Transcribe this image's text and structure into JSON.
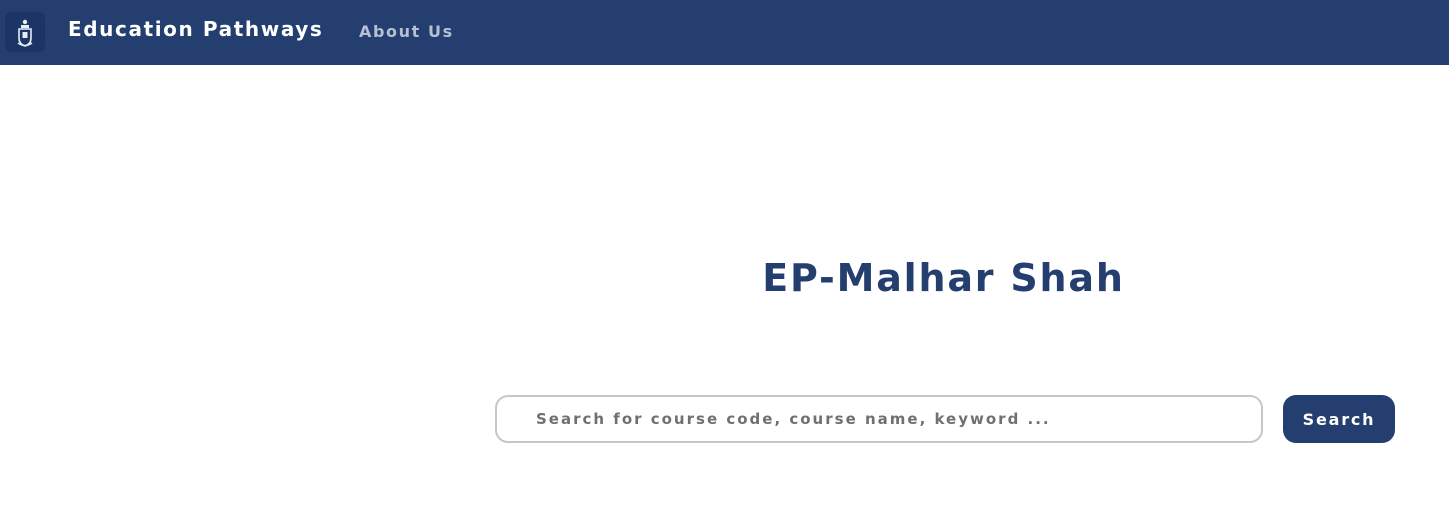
{
  "navbar": {
    "logo_icon": "university-crest-icon",
    "brand": "Education Pathways",
    "links": [
      {
        "label": "About Us"
      }
    ]
  },
  "main": {
    "title": "EP-Malhar Shah",
    "search": {
      "placeholder": "Search for course code, course name, keyword ...",
      "value": "",
      "button_label": "Search"
    }
  },
  "colors": {
    "navbar_bg": "#243e6f",
    "accent": "#243e6f",
    "nav_link": "#b7c0d3",
    "input_border": "#c5c7cc"
  }
}
